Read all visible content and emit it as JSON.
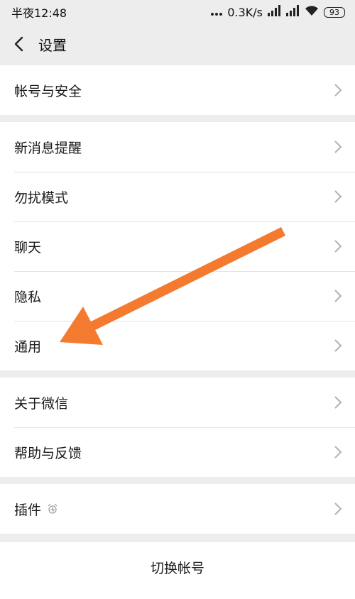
{
  "status_bar": {
    "time": "半夜12:48",
    "net_speed": "0.3K/s",
    "battery": "93"
  },
  "nav": {
    "title": "设置"
  },
  "groups": {
    "account": {
      "label": "帐号与安全"
    },
    "main": [
      {
        "label": "新消息提醒"
      },
      {
        "label": "勿扰模式"
      },
      {
        "label": "聊天"
      },
      {
        "label": "隐私"
      },
      {
        "label": "通用"
      }
    ],
    "about": [
      {
        "label": "关于微信"
      },
      {
        "label": "帮助与反馈"
      }
    ],
    "plugins": {
      "label": "插件"
    },
    "switch_account": {
      "label": "切换帐号"
    }
  },
  "colors": {
    "background": "#ededed",
    "card": "#ffffff",
    "arrow": "#f47a30",
    "chevron": "#b2b2b2"
  }
}
